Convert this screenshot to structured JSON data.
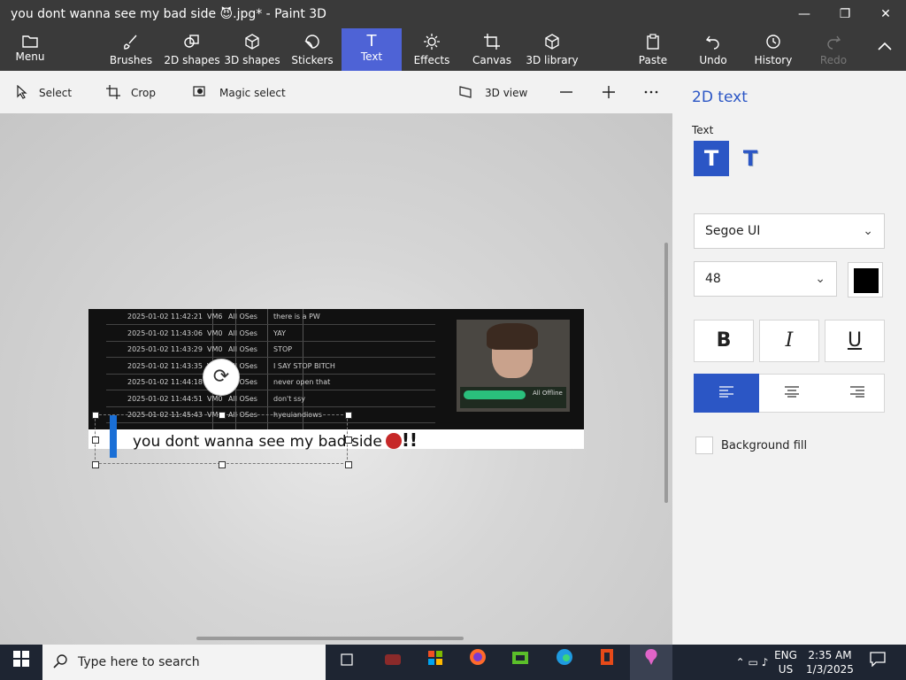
{
  "window": {
    "title": "you dont wanna see my bad side 😈.jpg* - Paint 3D",
    "minimize_glyph": "—",
    "maximize_glyph": "❐",
    "close_glyph": "✕"
  },
  "ribbon": {
    "menu": "Menu",
    "brushes": "Brushes",
    "shapes2d": "2D shapes",
    "shapes3d": "3D shapes",
    "stickers": "Stickers",
    "text": "Text",
    "effects": "Effects",
    "canvas": "Canvas",
    "library3d": "3D library",
    "paste": "Paste",
    "undo": "Undo",
    "history": "History",
    "redo": "Redo",
    "active_color": "#4e63d6"
  },
  "toolbar": {
    "select": "Select",
    "crop": "Crop",
    "magic_select": "Magic select",
    "view3d": "3D view"
  },
  "image": {
    "log_rows": [
      {
        "time": "2025-01-02 11:42:21",
        "vm": "VM6",
        "os": "All OSes",
        "msg": "there is a PW"
      },
      {
        "time": "2025-01-02 11:43:06",
        "vm": "VM0",
        "os": "All OSes",
        "msg": "YAY"
      },
      {
        "time": "2025-01-02 11:43:29",
        "vm": "VM0",
        "os": "All OSes",
        "msg": "STOP"
      },
      {
        "time": "2025-01-02 11:43:35",
        "vm": "VM0",
        "os": "All OSes",
        "msg": "I SAY STOP BITCH"
      },
      {
        "time": "2025-01-02 11:44:18",
        "vm": "VM6",
        "os": "All OSes",
        "msg": "never open that"
      },
      {
        "time": "2025-01-02 11:44:51",
        "vm": "VM0",
        "os": "All OSes",
        "msg": "don't ssy"
      },
      {
        "time": "2025-01-02 11:45:43",
        "vm": "VM0",
        "os": "All OSes",
        "msg": "hyeuiandiows"
      }
    ],
    "webcam_caption": "All Offline"
  },
  "textbox": {
    "text": "you dont wanna see my bad side",
    "suffix": "!!"
  },
  "panel": {
    "heading": "2D text",
    "text_label": "Text",
    "font": "Segoe UI",
    "size": "48",
    "color": "#000000",
    "bold": "B",
    "italic": "I",
    "underline": "U",
    "background_fill": "Background fill"
  },
  "taskbar": {
    "search_placeholder": "Type here to search",
    "lang_top": "ENG",
    "lang_bottom": "US",
    "time": "2:35 AM",
    "date": "1/3/2025"
  }
}
